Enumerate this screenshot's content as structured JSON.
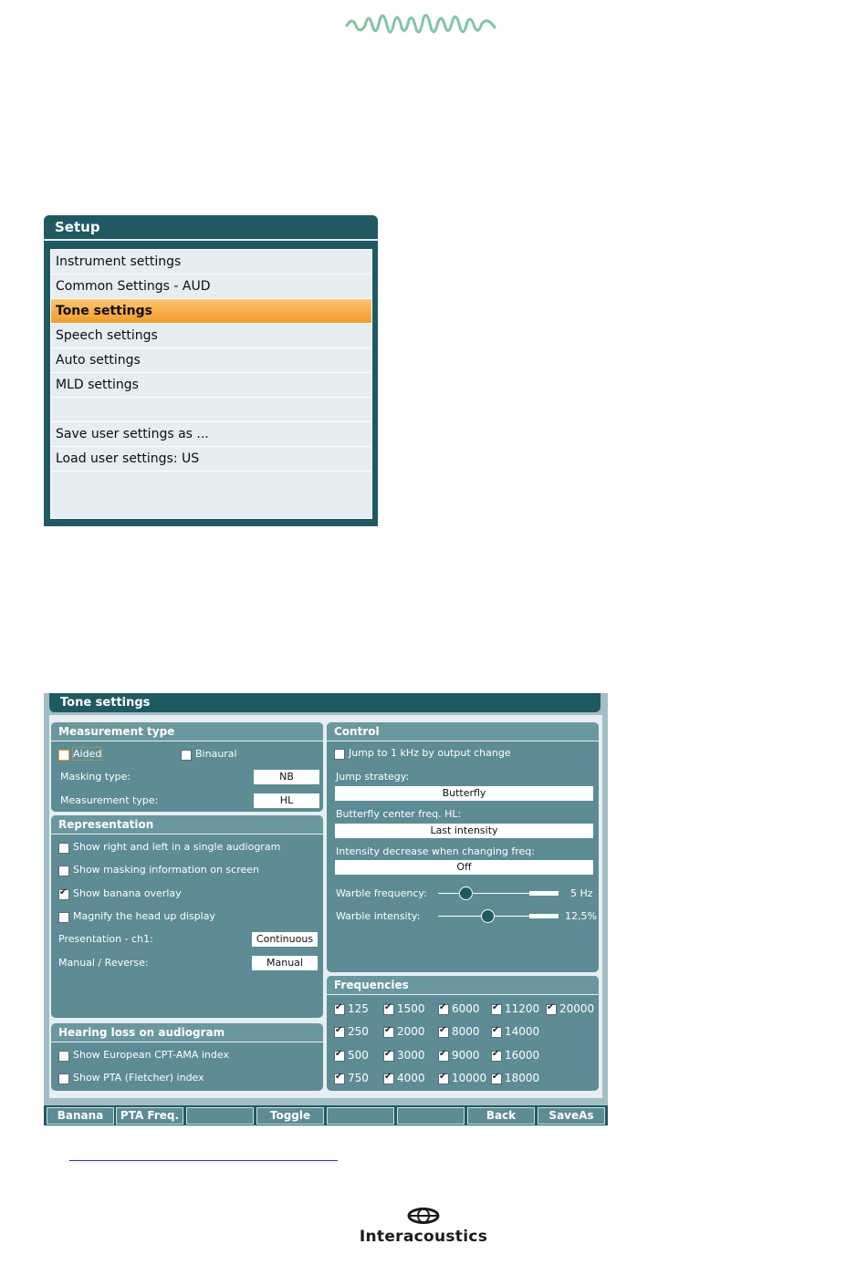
{
  "setup": {
    "title": "Setup",
    "items": [
      {
        "label": "Instrument settings",
        "active": false
      },
      {
        "label": "Common Settings - AUD",
        "active": false
      },
      {
        "label": "Tone settings",
        "active": true
      },
      {
        "label": "Speech settings",
        "active": false
      },
      {
        "label": "Auto settings",
        "active": false
      },
      {
        "label": "MLD settings",
        "active": false
      },
      {
        "label": "",
        "active": false
      },
      {
        "label": "Save user settings as ...",
        "active": false
      },
      {
        "label": "Load user settings: US",
        "active": false
      }
    ]
  },
  "tone": {
    "title": "Tone settings",
    "measurement": {
      "title": "Measurement type",
      "aided": {
        "label": "Aided",
        "checked": false
      },
      "binaural": {
        "label": "Binaural",
        "checked": false
      },
      "masking_type_label": "Masking type:",
      "masking_type_value": "NB",
      "measurement_type_label": "Measurement type:",
      "measurement_type_value": "HL"
    },
    "representation": {
      "title": "Representation",
      "options": [
        {
          "label": "Show right and left in a single audiogram",
          "checked": false
        },
        {
          "label": "Show masking information on screen",
          "checked": false
        },
        {
          "label": "Show banana overlay",
          "checked": true
        },
        {
          "label": "Magnify the head up display",
          "checked": false
        }
      ],
      "presentation_label": "Presentation - ch1:",
      "presentation_value": "Continuous",
      "manual_reverse_label": "Manual / Reverse:",
      "manual_reverse_value": "Manual"
    },
    "hearing_loss": {
      "title": "Hearing loss on audiogram",
      "options": [
        {
          "label": "Show European CPT-AMA index",
          "checked": false
        },
        {
          "label": "Show PTA (Fletcher) index",
          "checked": false
        }
      ]
    },
    "control": {
      "title": "Control",
      "jump": {
        "label": "Jump to 1 kHz by output change",
        "checked": false
      },
      "jump_strategy_label": "Jump strategy:",
      "jump_strategy_value": "Butterfly",
      "butterfly_label": "Butterfly center freq. HL:",
      "butterfly_value": "Last intensity",
      "intensity_label": "Intensity decrease when changing freq:",
      "intensity_value": "Off",
      "warble_freq_label": "Warble frequency:",
      "warble_freq_value": "5 Hz",
      "warble_freq_level": 0.2,
      "warble_int_label": "Warble intensity:",
      "warble_int_value": "12,5%",
      "warble_int_level": 0.5
    },
    "frequencies": {
      "title": "Frequencies",
      "rows": [
        [
          "125",
          "1500",
          "6000",
          "11200",
          "20000"
        ],
        [
          "250",
          "2000",
          "8000",
          "14000"
        ],
        [
          "500",
          "3000",
          "9000",
          "16000"
        ],
        [
          "750",
          "4000",
          "10000",
          "18000"
        ]
      ]
    },
    "buttons": [
      "Banana",
      "PTA Freq.",
      "",
      "Toggle",
      "",
      "",
      "Back",
      "SaveAs"
    ]
  },
  "brand": {
    "name": "Interacoustics"
  },
  "colors": {
    "dark_teal": "#1f5a63",
    "panel": "#5d8c94",
    "highlight": "#f39c2a",
    "wave": "#7fc6a4"
  }
}
